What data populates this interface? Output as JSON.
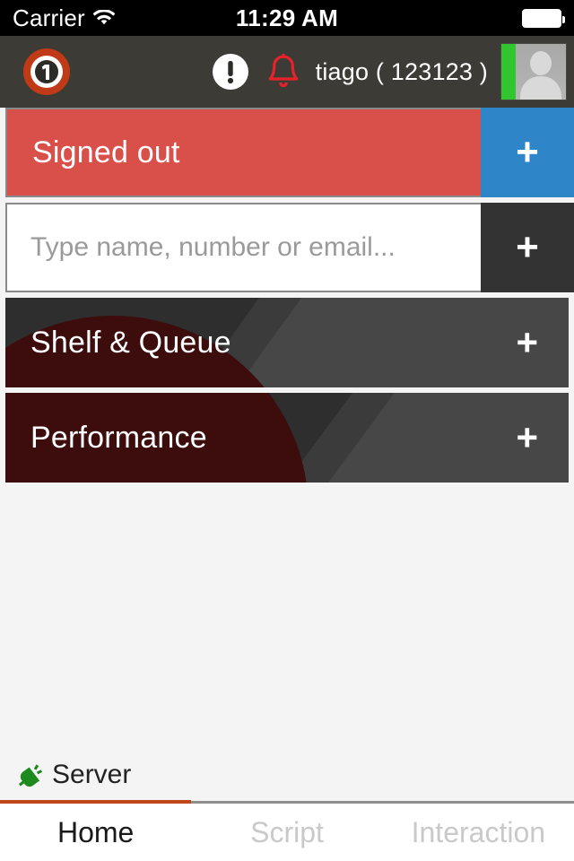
{
  "status_bar": {
    "carrier": "Carrier",
    "time": "11:29 AM",
    "wifi_icon": "wifi-icon",
    "battery_icon": "battery-full-icon"
  },
  "header": {
    "logo_icon": "app-logo-icon",
    "alert_icon": "exclamation-circle-icon",
    "bell_icon": "bell-icon",
    "user_label": "tiago ( 123123 )",
    "avatar_icon": "user-avatar-icon",
    "avatar_status_color": "#2fc62f"
  },
  "rows": {
    "signed_out": {
      "label": "Signed out",
      "bg_color": "#d94f4a",
      "add_label": "+",
      "add_bg_color": "#2e86c8"
    },
    "search": {
      "placeholder": "Type name, number or email...",
      "value": "",
      "add_label": "+",
      "add_bg_color": "#333333"
    },
    "tiles": [
      {
        "label": "Shelf & Queue",
        "add_label": "+"
      },
      {
        "label": "Performance",
        "add_label": "+"
      }
    ]
  },
  "server_bar": {
    "plug_icon": "plug-connected-icon",
    "label": "Server",
    "plug_color": "#1d8a1d"
  },
  "tabs": [
    {
      "label": "Home",
      "active": true
    },
    {
      "label": "Script",
      "active": false
    },
    {
      "label": "Interaction",
      "active": false
    }
  ],
  "theme": {
    "header_bg": "#3d3b36",
    "tile_dark_red": "#3d0d0d",
    "tile_gray_dark": "#2e2e2e",
    "tile_gray_light": "#474747",
    "tab_active_underline": "#c0461c"
  }
}
